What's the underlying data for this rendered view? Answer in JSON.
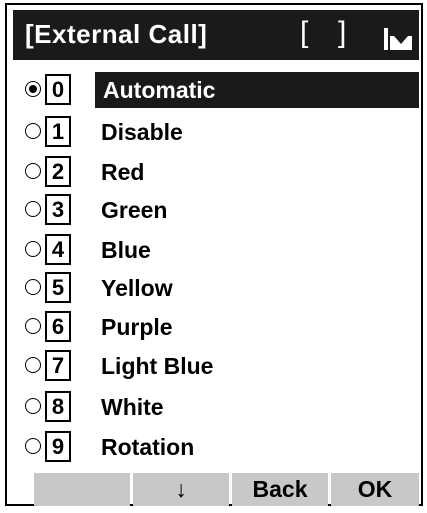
{
  "header": {
    "title": "[External Call]",
    "bracket_open": "[",
    "bracket_close": "]",
    "tray_icon": "tray-arrow-icon"
  },
  "options": [
    {
      "number": "0",
      "label": "Automatic",
      "selected": true
    },
    {
      "number": "1",
      "label": "Disable",
      "selected": false
    },
    {
      "number": "2",
      "label": "Red",
      "selected": false
    },
    {
      "number": "3",
      "label": "Green",
      "selected": false
    },
    {
      "number": "4",
      "label": "Blue",
      "selected": false
    },
    {
      "number": "5",
      "label": "Yellow",
      "selected": false
    },
    {
      "number": "6",
      "label": "Purple",
      "selected": false
    },
    {
      "number": "7",
      "label": "Light Blue",
      "selected": false
    },
    {
      "number": "8",
      "label": "White",
      "selected": false
    },
    {
      "number": "9",
      "label": "Rotation",
      "selected": false
    }
  ],
  "softkeys": [
    {
      "label": ""
    },
    {
      "label": "↓"
    },
    {
      "label": "Back"
    },
    {
      "label": "OK"
    }
  ],
  "colors": {
    "highlight": "#1a1a1a",
    "softkey_bg": "#c8c8c8"
  }
}
